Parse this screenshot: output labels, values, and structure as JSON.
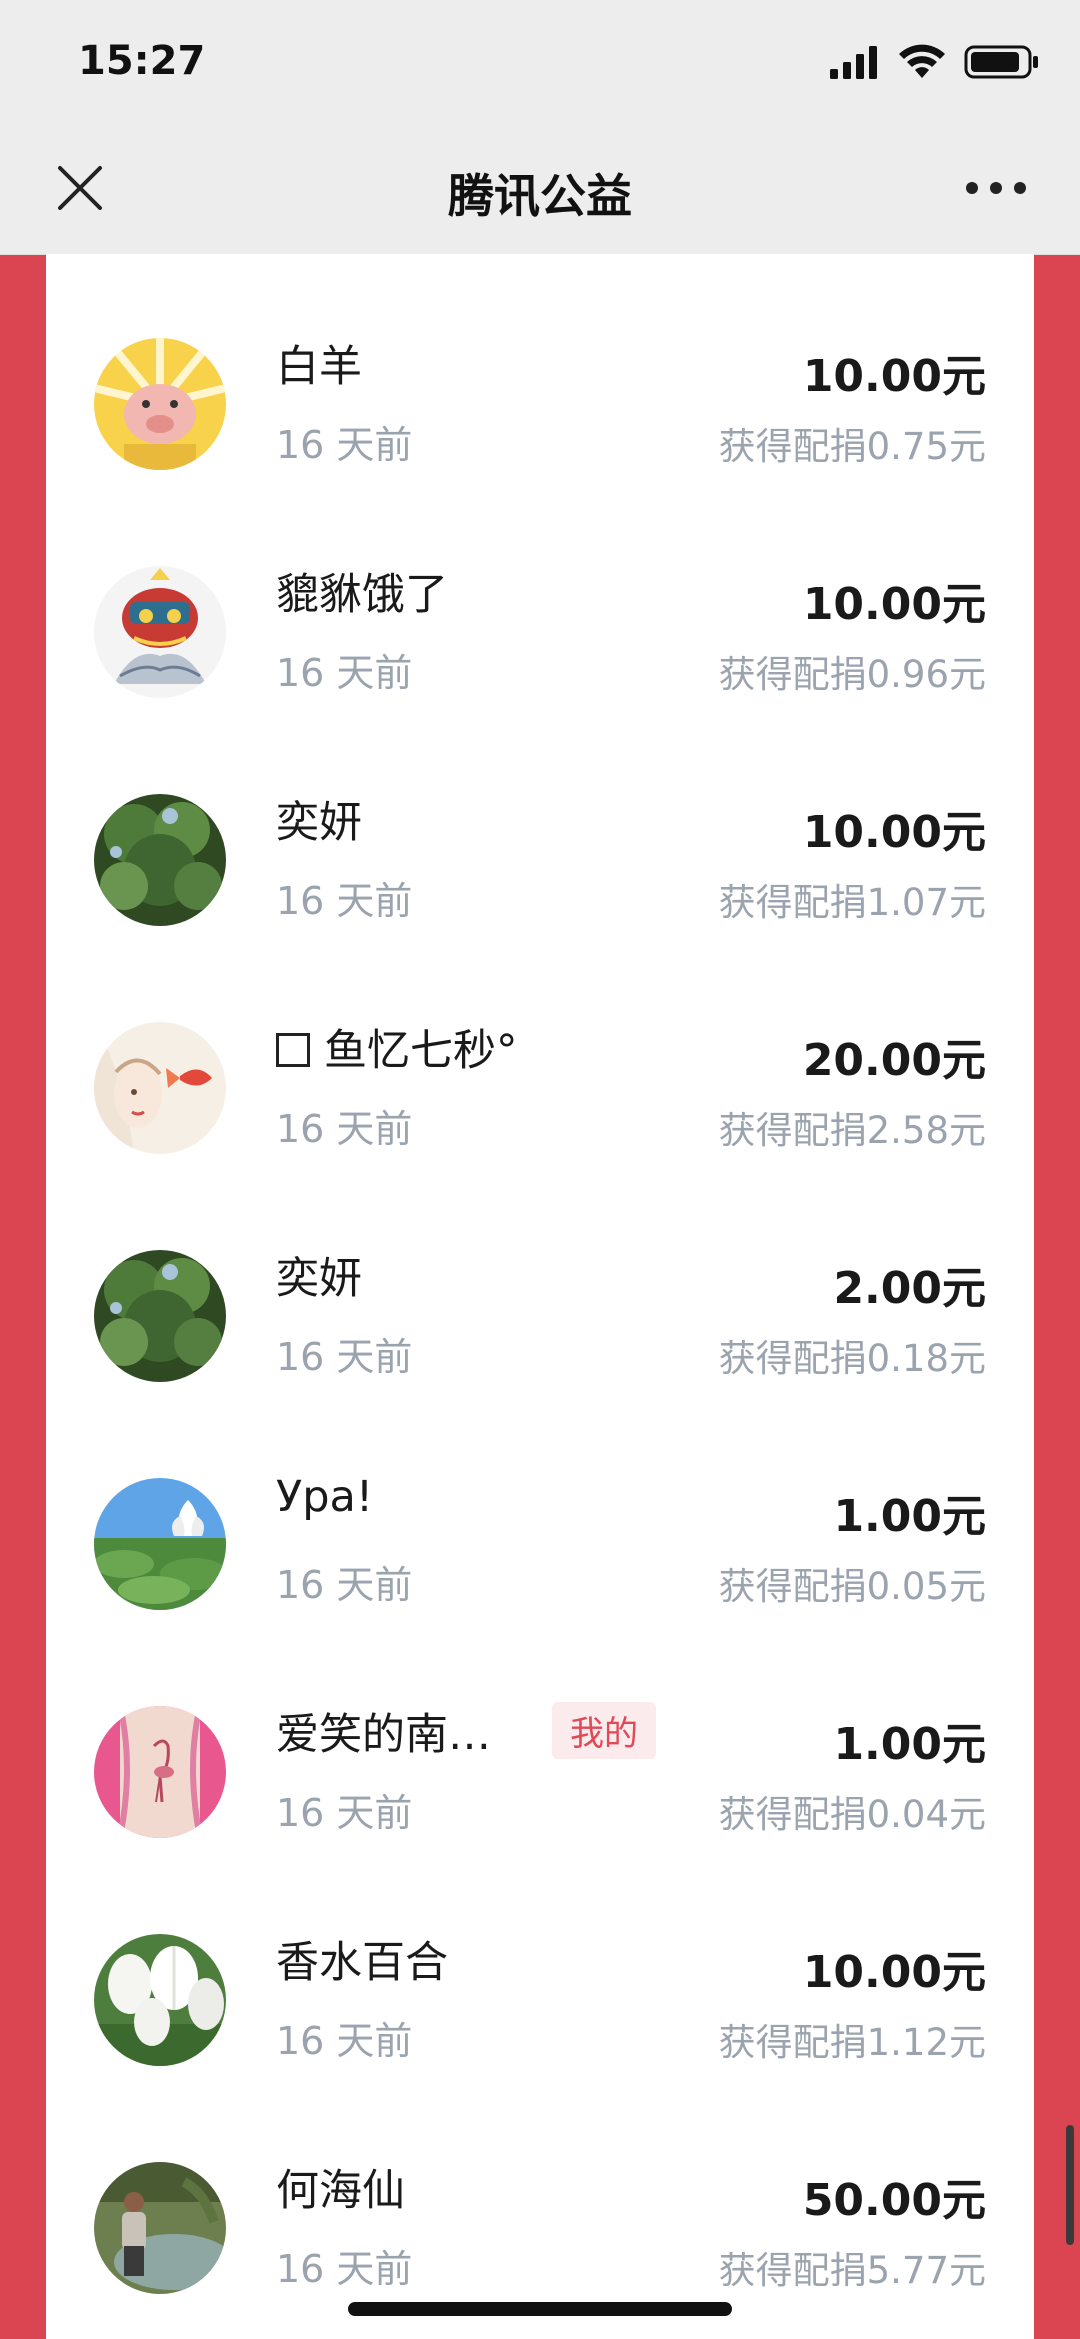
{
  "status_bar": {
    "time": "15:27",
    "signal_icon": "cellular-signal-icon",
    "wifi_icon": "wifi-icon",
    "battery_icon": "battery-icon"
  },
  "nav": {
    "close_icon": "close-icon",
    "title": "腾讯公益",
    "more_icon": "more-dots-icon"
  },
  "colors": {
    "page_background": "#DB4451",
    "card_background": "#FFFFFF",
    "badge_background": "#FCEBEC",
    "badge_text": "#E14957",
    "secondary_text": "#9AA3AE"
  },
  "donations": [
    {
      "name": "白羊",
      "time": "16 天前",
      "amount": "10.00元",
      "match": "获得配捐0.75元",
      "avatar": "cartoon-pig-avatar"
    },
    {
      "name": "貔貅饿了",
      "time": "16 天前",
      "amount": "10.00元",
      "match": "获得配捐0.96元",
      "avatar": "lion-dance-avatar"
    },
    {
      "name": "奕妍",
      "time": "16 天前",
      "amount": "10.00元",
      "match": "获得配捐1.07元",
      "avatar": "tree-avatar"
    },
    {
      "name": "鱼忆七秒°",
      "time": "16 天前",
      "amount": "20.00元",
      "match": "获得配捐2.58元",
      "avatar": "painted-girl-fish-avatar",
      "prefix_box": true
    },
    {
      "name": "奕妍",
      "time": "16 天前",
      "amount": "2.00元",
      "match": "获得配捐0.18元",
      "avatar": "tree-avatar"
    },
    {
      "name": "Ура!",
      "time": "16 天前",
      "amount": "1.00元",
      "match": "获得配捐0.05元",
      "avatar": "lotus-sky-avatar"
    },
    {
      "name": "爱笑的南…",
      "time": "16 天前",
      "amount": "1.00元",
      "match": "获得配捐0.04元",
      "avatar": "flamingo-tattoo-avatar",
      "badge": "我的"
    },
    {
      "name": "香水百合",
      "time": "16 天前",
      "amount": "10.00元",
      "match": "获得配捐1.12元",
      "avatar": "white-tulips-avatar"
    },
    {
      "name": "何海仙",
      "time": "16 天前",
      "amount": "50.00元",
      "match": "获得配捐5.77元",
      "avatar": "person-outdoors-avatar"
    }
  ]
}
